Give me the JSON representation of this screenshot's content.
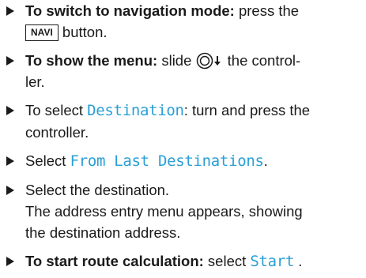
{
  "steps": [
    {
      "lead": "To switch to navigation mode:",
      "text1": " press the ",
      "key": "NAVI",
      "text2": " button."
    },
    {
      "lead": "To show the menu:",
      "text1": " slide ",
      "controller_icon": "controller-knob-icon",
      "arrow_icon": "arrow-down-icon",
      "text2": " the control-",
      "text3": "ler."
    },
    {
      "text1": "To select ",
      "menu_item": "Destination",
      "text2": ": turn and press the",
      "text3": "controller."
    },
    {
      "text1": "Select ",
      "menu_item": "From Last Destinations",
      "text2": "."
    },
    {
      "text1": "Select the destination.",
      "text2": "The address entry menu appears, showing",
      "text3": "the destination address."
    },
    {
      "lead": "To start route calculation:",
      "text1": " select ",
      "menu_item": "Start",
      "text2": " ."
    }
  ],
  "colors": {
    "text": "#1a1a1a",
    "highlight": "#2a9fd6"
  }
}
